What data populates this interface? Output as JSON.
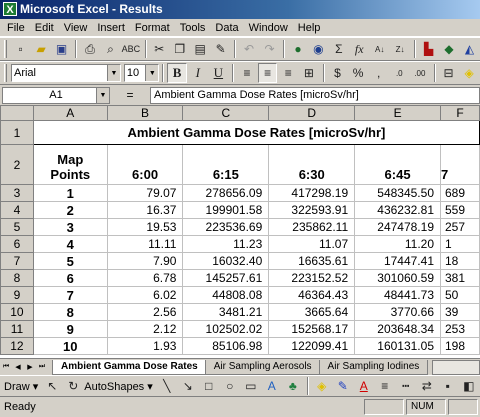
{
  "window": {
    "title": "Microsoft Excel - Results"
  },
  "menu": [
    "File",
    "Edit",
    "View",
    "Insert",
    "Format",
    "Tools",
    "Data",
    "Window",
    "Help"
  ],
  "format_toolbar": {
    "font_name": "Arial",
    "font_size": "10"
  },
  "formula_bar": {
    "cell_ref": "A1",
    "equals": "=",
    "content": "Ambient Gamma Dose Rates [microSv/hr]"
  },
  "grid": {
    "columns": [
      "A",
      "B",
      "C",
      "D",
      "E",
      "F"
    ],
    "row_numbers": [
      "1",
      "2",
      "3",
      "4",
      "5",
      "6",
      "7",
      "8",
      "9",
      "10",
      "11",
      "12"
    ],
    "title": "Ambient Gamma Dose Rates [microSv/hr]",
    "headers": [
      "Map\nPoints",
      "6:00",
      "6:15",
      "6:30",
      "6:45",
      "7"
    ],
    "rows": [
      [
        "1",
        "79.07",
        "278656.09",
        "417298.19",
        "548345.50",
        "689"
      ],
      [
        "2",
        "16.37",
        "199901.58",
        "322593.91",
        "436232.81",
        "559"
      ],
      [
        "3",
        "19.53",
        "223536.69",
        "235862.11",
        "247478.19",
        "257"
      ],
      [
        "4",
        "11.11",
        "11.23",
        "11.07",
        "11.20",
        "1"
      ],
      [
        "5",
        "7.90",
        "16032.40",
        "16635.61",
        "17447.41",
        "18"
      ],
      [
        "6",
        "6.78",
        "145257.61",
        "223152.52",
        "301060.59",
        "381"
      ],
      [
        "7",
        "6.02",
        "44808.08",
        "46364.43",
        "48441.73",
        "50"
      ],
      [
        "8",
        "2.56",
        "3481.21",
        "3665.64",
        "3770.66",
        "39"
      ],
      [
        "9",
        "2.12",
        "102502.02",
        "152568.17",
        "203648.34",
        "253"
      ],
      [
        "10",
        "1.93",
        "85106.98",
        "122099.41",
        "160131.05",
        "198"
      ]
    ]
  },
  "sheet_tabs": [
    "Ambient Gamma Dose Rates",
    "Air Sampling Aerosols",
    "Air Sampling Iodines"
  ],
  "drawing_toolbar": {
    "draw": "Draw ▾",
    "autoshapes": "AutoShapes ▾"
  },
  "status": {
    "text": "Ready",
    "num": "NUM"
  }
}
